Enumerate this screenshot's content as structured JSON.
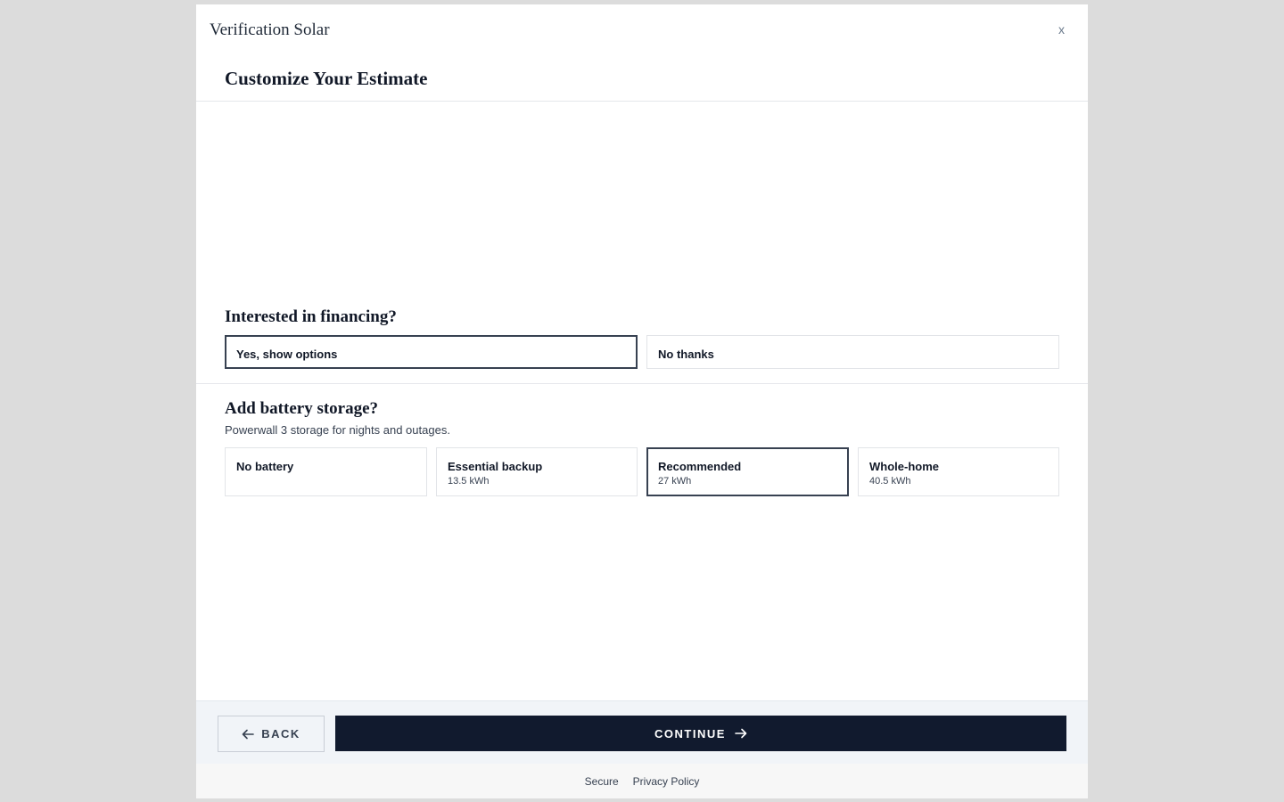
{
  "modal": {
    "brand": "Verification Solar",
    "close_label": "x",
    "title": "Customize Your Estimate"
  },
  "financing": {
    "question": "Interested in financing?",
    "options": [
      {
        "label": "Yes, show options",
        "selected": true
      },
      {
        "label": "No thanks",
        "selected": false
      }
    ]
  },
  "battery": {
    "question": "Add battery storage?",
    "subtitle": "Powerwall 3 storage for nights and outages.",
    "options": [
      {
        "label": "No battery",
        "detail": "",
        "selected": false
      },
      {
        "label": "Essential backup",
        "detail": "13.5 kWh",
        "selected": false
      },
      {
        "label": "Recommended",
        "detail": "27 kWh",
        "selected": true
      },
      {
        "label": "Whole-home",
        "detail": "40.5 kWh",
        "selected": false
      }
    ]
  },
  "footer": {
    "back_label": "BACK",
    "continue_label": "CONTINUE",
    "back_icon": "arrow-left-icon",
    "continue_icon": "arrow-right-icon"
  },
  "legal": {
    "secure": "Secure",
    "privacy": "Privacy Policy"
  },
  "colors": {
    "primary": "#111a2e",
    "backdrop": "#dcdcdc",
    "selected_border": "#374151"
  }
}
